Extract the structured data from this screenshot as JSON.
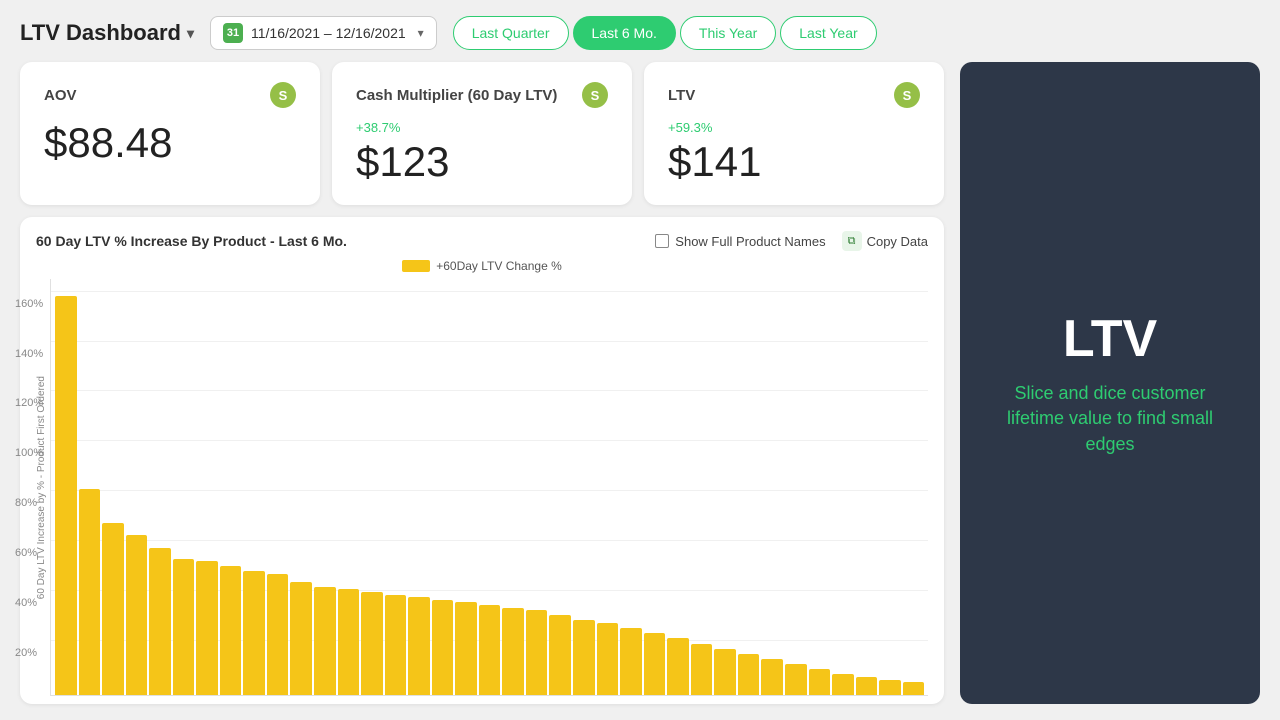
{
  "header": {
    "title": "LTV Dashboard",
    "dropdown_icon": "▾",
    "date_range": "11/16/2021 – 12/16/2021",
    "date_chevron": "▾"
  },
  "period_buttons": [
    {
      "label": "Last Quarter",
      "active": false,
      "key": "last_quarter"
    },
    {
      "label": "Last 6 Mo.",
      "active": true,
      "key": "last_6mo"
    },
    {
      "label": "This Year",
      "active": false,
      "key": "this_year"
    },
    {
      "label": "Last Year",
      "active": false,
      "key": "last_year"
    }
  ],
  "metrics": [
    {
      "label": "AOV",
      "value": "$88.48",
      "change": null,
      "shopify": true
    },
    {
      "label": "Cash Multiplier (60 Day LTV)",
      "value": "$123",
      "change": "+38.7%",
      "shopify": true
    },
    {
      "label": "LTV",
      "value": "$141",
      "change": "+59.3%",
      "shopify": true
    }
  ],
  "promo": {
    "title": "LTV",
    "subtitle": "Slice and dice customer lifetime value to find small edges"
  },
  "chart": {
    "title": "60 Day LTV % Increase By Product - Last 6 Mo.",
    "show_full_names_label": "Show Full Product Names",
    "copy_data_label": "Copy Data",
    "legend_label": "+60Day LTV Change %",
    "y_axis_label": "60 Day LTV Increase by % - Product First Ordered",
    "y_labels": [
      "160%",
      "140%",
      "120%",
      "100%",
      "80%",
      "60%",
      "40%",
      "20%"
    ],
    "bars": [
      155,
      80,
      67,
      62,
      57,
      53,
      52,
      50,
      48,
      47,
      44,
      42,
      41,
      40,
      39,
      38,
      37,
      36,
      35,
      34,
      33,
      31,
      29,
      28,
      26,
      24,
      22,
      20,
      18,
      16,
      14,
      12,
      10,
      8,
      7,
      6,
      5
    ]
  }
}
